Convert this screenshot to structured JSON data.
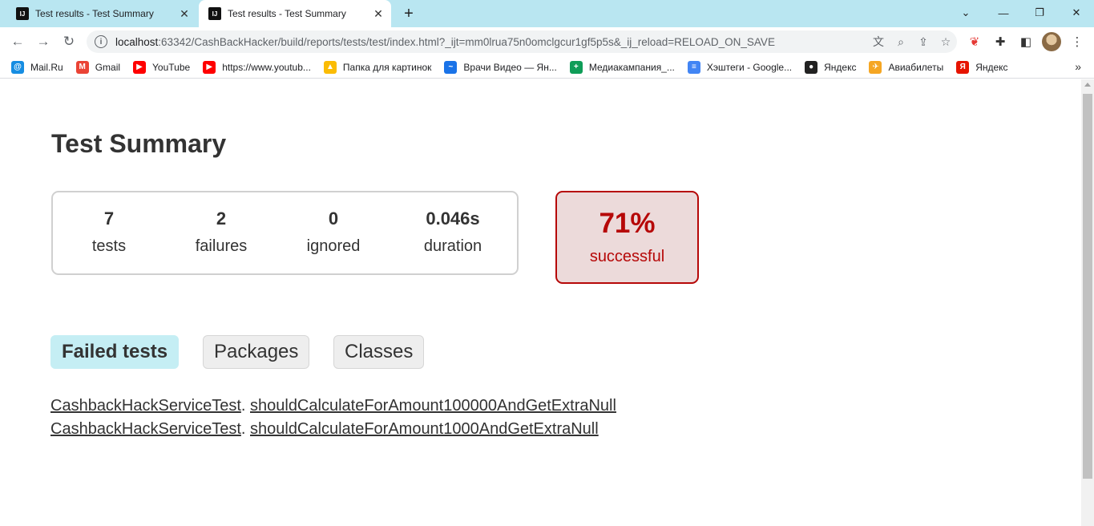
{
  "browser": {
    "tabs": [
      {
        "title": "Test results - Test Summary",
        "favicon": "IJ",
        "active": false
      },
      {
        "title": "Test results - Test Summary",
        "favicon": "IJ",
        "active": true
      }
    ],
    "url_host": "localhost",
    "url_rest": ":63342/CashBackHacker/build/reports/tests/test/index.html?_ijt=mm0lrua75n0omclgcur1gf5p5s&_ij_reload=RELOAD_ON_SAVE",
    "bookmarks": [
      {
        "label": "Mail.Ru",
        "color": "#168de2",
        "glyph": "@"
      },
      {
        "label": "Gmail",
        "color": "#ea4335",
        "glyph": "M"
      },
      {
        "label": "YouTube",
        "color": "#ff0000",
        "glyph": "▶"
      },
      {
        "label": "https://www.youtub...",
        "color": "#ff0000",
        "glyph": "▶"
      },
      {
        "label": "Папка для картинок",
        "color": "#fbbc04",
        "glyph": "▲"
      },
      {
        "label": "Врачи Видео — Ян...",
        "color": "#1a73e8",
        "glyph": "~"
      },
      {
        "label": "Медиакампания_...",
        "color": "#0f9d58",
        "glyph": "+"
      },
      {
        "label": "Хэштеги - Google...",
        "color": "#4285f4",
        "glyph": "≡"
      },
      {
        "label": "Яндекс",
        "color": "#222222",
        "glyph": "●"
      },
      {
        "label": "Авиабилеты",
        "color": "#f5a623",
        "glyph": "✈"
      },
      {
        "label": "Яндекс",
        "color": "#e61400",
        "glyph": "Я"
      }
    ]
  },
  "page": {
    "title": "Test Summary",
    "counters": [
      {
        "value": "7",
        "label": "tests"
      },
      {
        "value": "2",
        "label": "failures"
      },
      {
        "value": "0",
        "label": "ignored"
      },
      {
        "value": "0.046s",
        "label": "duration"
      }
    ],
    "success_rate": {
      "value": "71%",
      "label": "successful"
    },
    "tabs": [
      {
        "label": "Failed tests",
        "selected": true
      },
      {
        "label": "Packages",
        "selected": false
      },
      {
        "label": "Classes",
        "selected": false
      }
    ],
    "failed_tests": [
      {
        "class": "CashbackHackServiceTest",
        "method": "shouldCalculateForAmount100000AndGetExtraNull"
      },
      {
        "class": "CashbackHackServiceTest",
        "method": "shouldCalculateForAmount1000AndGetExtraNull"
      }
    ]
  },
  "colors": {
    "tabstrip": "#b9e6f1",
    "failure_red": "#b60808",
    "failure_bg": "#ecdada",
    "selected_tab": "#c5eef4"
  }
}
